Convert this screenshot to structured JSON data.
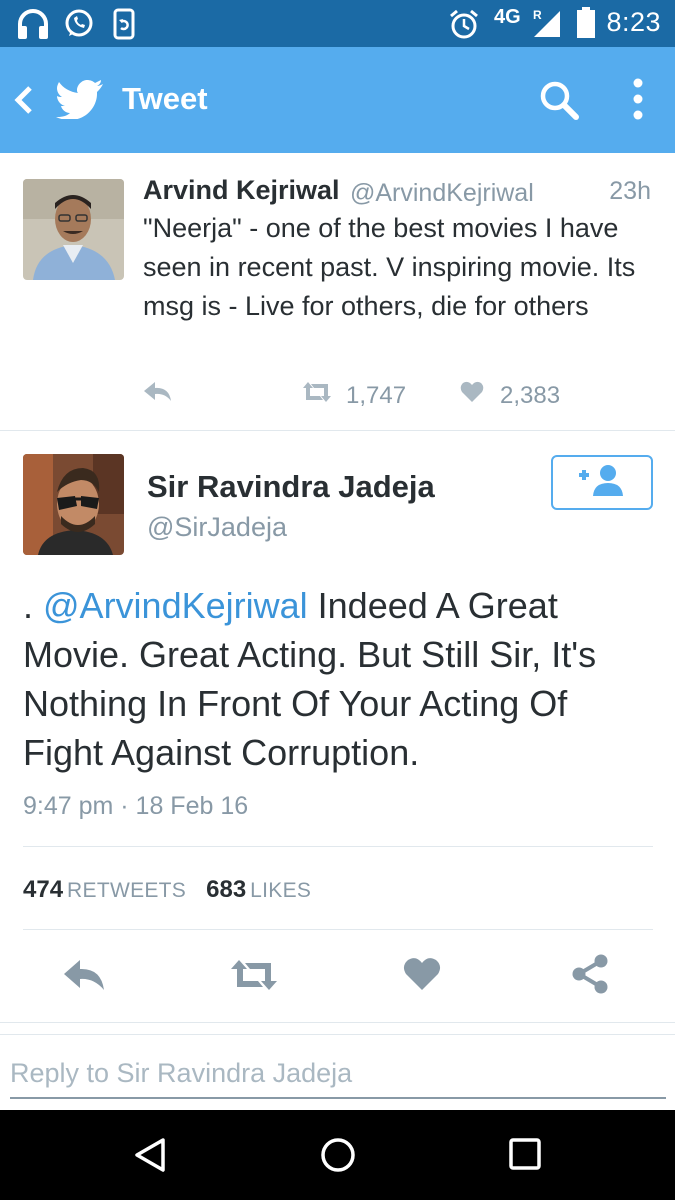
{
  "status_bar": {
    "network": "4G",
    "network_sub": "R",
    "time": "8:23",
    "icons": [
      "headset-icon",
      "whatsapp-icon",
      "phone-sync-icon",
      "alarm-icon",
      "signal-icon",
      "battery-icon"
    ]
  },
  "app_bar": {
    "title": "Tweet",
    "icons": [
      "back-icon",
      "twitter-bird-icon",
      "search-icon",
      "more-icon"
    ],
    "color": "#55acee"
  },
  "parent_tweet": {
    "author_name": "Arvind Kejriwal",
    "author_handle": "@ArvindKejriwal",
    "time": "23h",
    "text": "\"Neerja\" - one of the best movies I have seen in recent past. V inspiring movie. Its msg is - Live for others, die for others",
    "retweets": "1,747",
    "likes": "2,383"
  },
  "main_tweet": {
    "author_name": "Sir Ravindra Jadeja",
    "author_handle": "@SirJadeja",
    "text_prefix": ". ",
    "mention": "@ArvindKejriwal",
    "text_body": " Indeed A Great Movie. Great Acting. But Still Sir, It's Nothing In Front Of Your Acting Of Fight Against Corruption.",
    "datetime": "9:47 pm · 18 Feb 16",
    "retweet_count": "474",
    "retweet_label": "RETWEETS",
    "like_count": "683",
    "like_label": "LIKES",
    "mention_color": "#3b94d9"
  },
  "reply": {
    "placeholder": "Reply to Sir Ravindra Jadeja"
  },
  "nav_bar": {
    "icons": [
      "nav-back-icon",
      "nav-home-icon",
      "nav-recents-icon"
    ]
  }
}
